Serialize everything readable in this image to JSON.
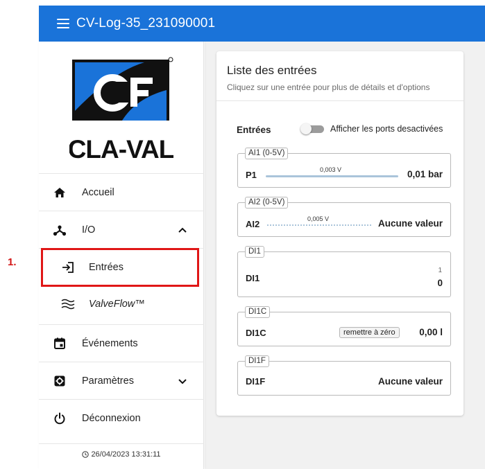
{
  "app": {
    "title": "CV-Log-35_231090001"
  },
  "logo": {
    "text": "CLA-VAL",
    "brand_color": "#1a73d9"
  },
  "sidebar": {
    "items": [
      {
        "label": "Accueil",
        "icon": "home-icon"
      },
      {
        "label": "I/O",
        "icon": "io-icon",
        "expanded": true
      },
      {
        "label": "Entrées",
        "icon": "input-icon"
      },
      {
        "label": "ValveFlow™",
        "icon": "valveflow-icon"
      },
      {
        "label": "Événements",
        "icon": "calendar-icon"
      },
      {
        "label": "Paramètres",
        "icon": "settings-icon",
        "expanded": false
      },
      {
        "label": "Déconnexion",
        "icon": "power-icon"
      }
    ],
    "timestamp": "26/04/2023 13:31:11"
  },
  "annotation": {
    "number": "1."
  },
  "card": {
    "title": "Liste des entrées",
    "subtitle": "Cliquez sur une entrée pour plus de détails et d'options",
    "section_label": "Entrées",
    "toggle_label": "Afficher les ports desactivées",
    "toggle_on": false,
    "ports": [
      {
        "legend": "AI1 (0-5V)",
        "name": "P1",
        "voltage": "0,003 V",
        "value": "0,01 bar"
      },
      {
        "legend": "AI2 (0-5V)",
        "name": "AI2",
        "voltage": "0,005 V",
        "value": "Aucune valeur"
      },
      {
        "legend": "DI1",
        "name": "DI1",
        "count": "1",
        "value": "0"
      },
      {
        "legend": "DI1C",
        "name": "DI1C",
        "button": "remettre à zéro",
        "value": "0,00 l"
      },
      {
        "legend": "DI1F",
        "name": "DI1F",
        "value": "Aucune valeur"
      }
    ]
  },
  "colors": {
    "accent": "#1a73d9",
    "annotation": "#e01616"
  }
}
